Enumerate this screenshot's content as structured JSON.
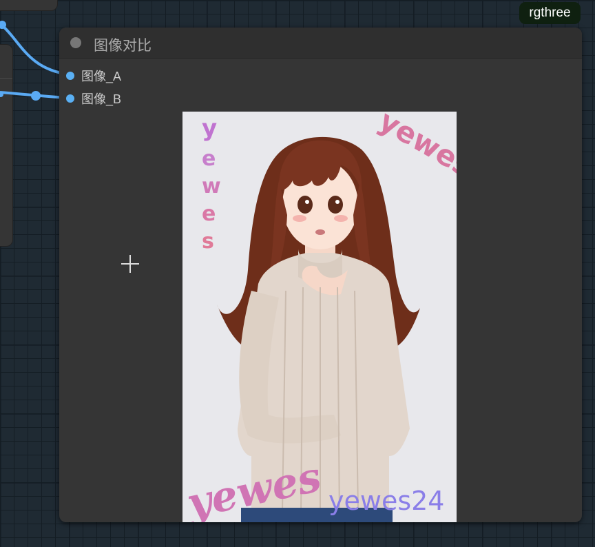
{
  "badge": {
    "label": "rgthree"
  },
  "node": {
    "title": "图像对比",
    "inputs": [
      {
        "label": "图像_A"
      },
      {
        "label": "图像_B"
      }
    ]
  },
  "image": {
    "watermarks": [
      "yewes",
      "yewes",
      "yewes",
      "yewes24"
    ]
  },
  "colors": {
    "slot_dot": "#5ab0f4",
    "wire": "#5aaaf4",
    "badge_bg": "#0f2010",
    "node_bg": "#353535"
  }
}
